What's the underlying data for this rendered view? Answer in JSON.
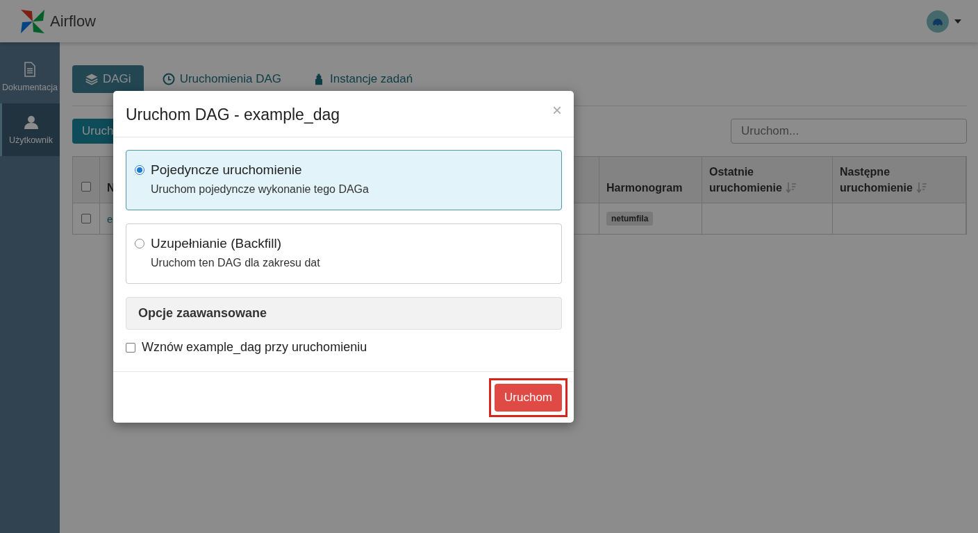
{
  "header": {
    "brand": "Airflow"
  },
  "sidebar": {
    "items": [
      {
        "label": "Dokumentacja",
        "selected": false
      },
      {
        "label": "Użytkownik",
        "selected": true
      }
    ]
  },
  "tabs": [
    {
      "label": "DAGi",
      "selected": true
    },
    {
      "label": "Uruchomienia DAG",
      "selected": false
    },
    {
      "label": "Instancje zadań",
      "selected": false
    }
  ],
  "toolbar": {
    "button": "Uruch",
    "search": {
      "placeholder": "Uruchom..."
    }
  },
  "table": {
    "select_all_checked": false,
    "columns": [
      {
        "label": "N"
      },
      {
        "label": "Harmonogram"
      },
      {
        "label": "Ostatnie uruchomienie",
        "sortable": true
      },
      {
        "label": "Następne uruchomienie",
        "sortable": true
      }
    ],
    "rows": [
      {
        "checked": false,
        "name": "e",
        "schedule": "netumfila",
        "last_run": "",
        "next_run": ""
      }
    ]
  },
  "modal": {
    "title": "Uruchom DAG - example_dag",
    "close": "×",
    "options": [
      {
        "title": "Pojedyncze uruchomienie",
        "description": "Uruchom pojedyncze wykonanie tego DAGa",
        "selected": true
      },
      {
        "title": "Uzupełnianie (Backfill)",
        "description": "Uruchom ten DAG dla zakresu dat",
        "selected": false
      }
    ],
    "advanced": "Opcje zaawansowane",
    "unpause": {
      "label": "Wznów example_dag przy uruchomieniu",
      "checked": false
    },
    "submit": {
      "label": "Uruchom",
      "highlighted": true
    }
  }
}
